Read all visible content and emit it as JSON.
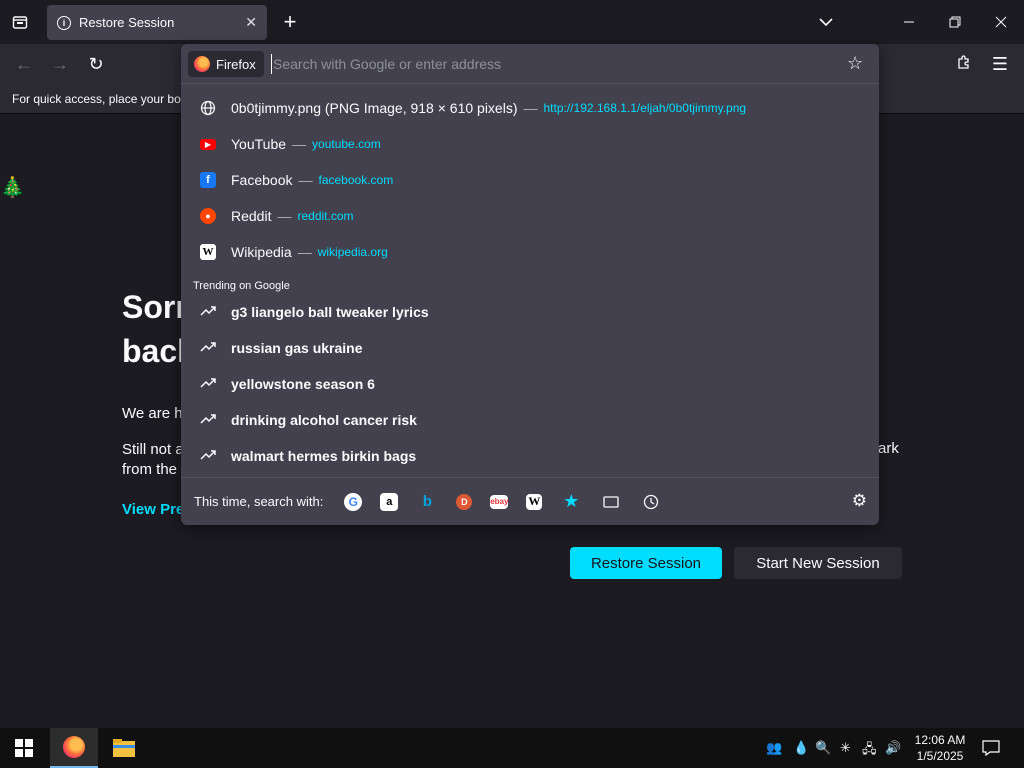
{
  "tab": {
    "title": "Restore Session"
  },
  "bookmarks_toolbar": {
    "text": "For quick access, place your bookmarks here"
  },
  "page": {
    "heading_line1": "Sorr",
    "heading_line2": "back",
    "para1": "We are h",
    "para2_line1": "Still not a",
    "para2_line2": "from the",
    "para2_right": "ark",
    "view_previous": "View Pre",
    "restore_button": "Restore Session",
    "new_session_button": "Start New Session"
  },
  "urlbar": {
    "identity_label": "Firefox",
    "placeholder": "Search with Google or enter address"
  },
  "suggestions": [
    {
      "title": "0b0tjimmy.png (PNG Image, 918 × 610 pixels)",
      "url": "http://192.168.1.1/eljah/0b0tjimmy.png",
      "icon": "globe-icon"
    },
    {
      "title": "YouTube",
      "url": "youtube.com",
      "icon": "youtube-icon"
    },
    {
      "title": "Facebook",
      "url": "facebook.com",
      "icon": "facebook-icon"
    },
    {
      "title": "Reddit",
      "url": "reddit.com",
      "icon": "reddit-icon"
    },
    {
      "title": "Wikipedia",
      "url": "wikipedia.org",
      "icon": "wikipedia-icon"
    }
  ],
  "trending_header": "Trending on Google",
  "trending": [
    "g3 liangelo ball tweaker lyrics",
    "russian gas ukraine",
    "yellowstone season 6",
    "drinking alcohol cancer risk",
    "walmart hermes birkin bags"
  ],
  "one_off": {
    "label": "This time, search with:",
    "engines": [
      "google-icon",
      "amazon-icon",
      "bing-icon",
      "duckduckgo-icon",
      "ebay-icon",
      "wikipedia-icon",
      "bookmarks-icon",
      "tabs-icon",
      "history-icon"
    ]
  },
  "taskbar": {
    "time": "12:06 AM",
    "date": "1/5/2025"
  },
  "colors": {
    "accent": "#00ddff",
    "panel": "#42414d",
    "background": "#1c1b22"
  }
}
